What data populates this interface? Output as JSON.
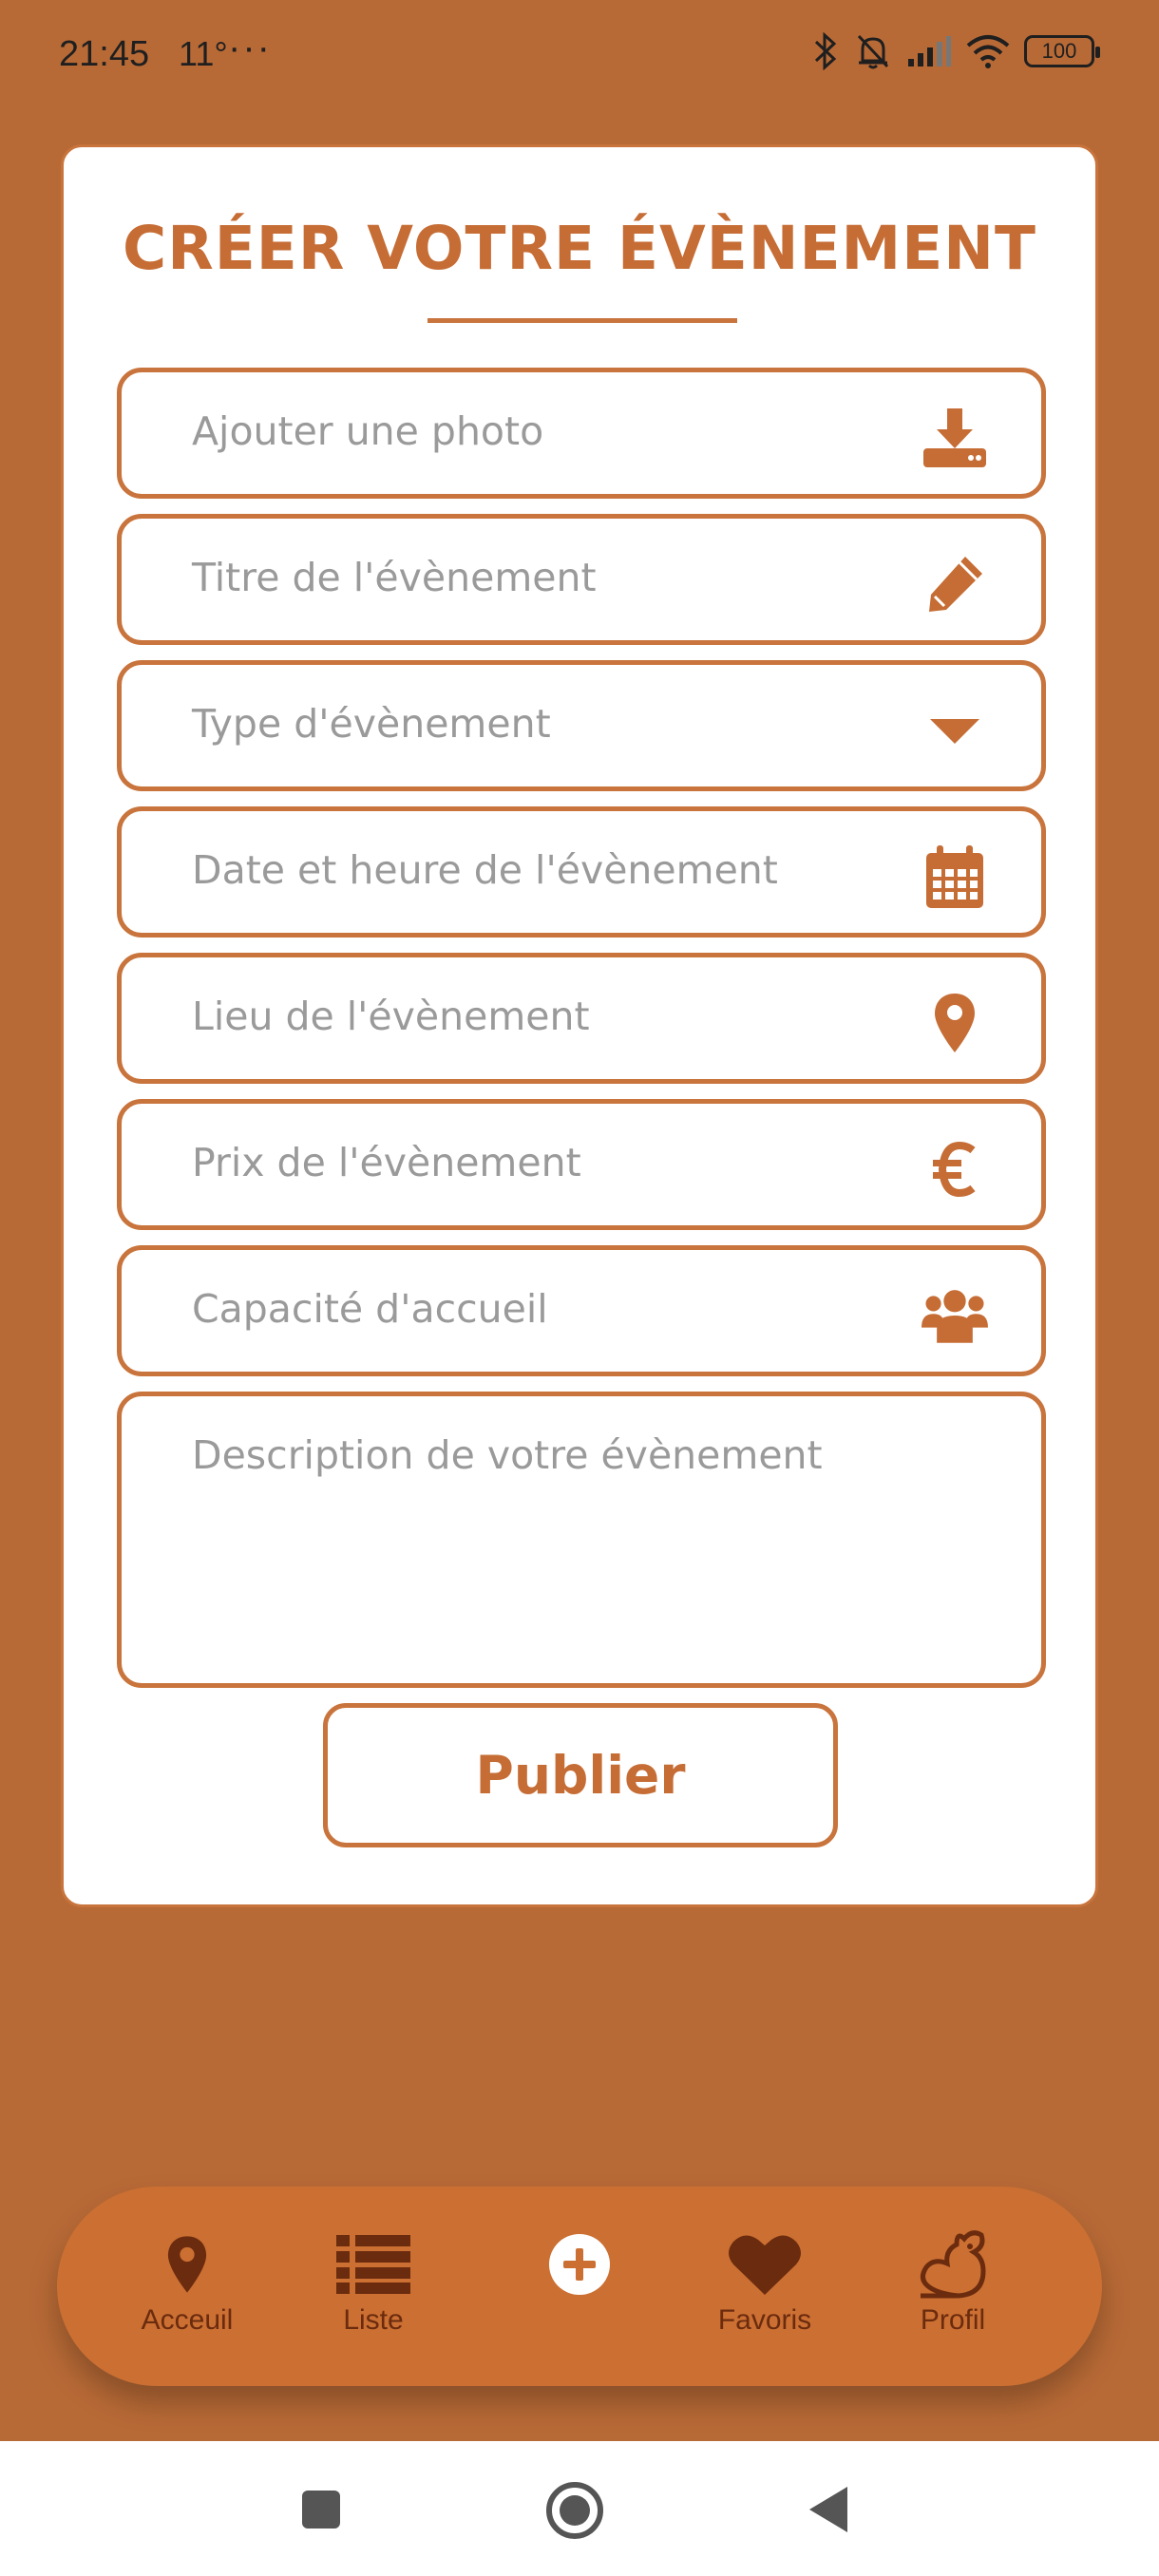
{
  "status_bar": {
    "time": "21:45",
    "temperature": "11°",
    "dots": "···",
    "battery": "100"
  },
  "form": {
    "title": "CRÉER VOTRE ÉVÈNEMENT",
    "fields": [
      {
        "label": "Ajouter une photo",
        "icon": "download-icon"
      },
      {
        "label": "Titre de l'évènement",
        "icon": "pencil-icon"
      },
      {
        "label": "Type d'évènement",
        "icon": "caret-down-icon"
      },
      {
        "label": "Date et heure de l'évènement",
        "icon": "calendar-icon"
      },
      {
        "label": "Lieu de l'évènement",
        "icon": "map-pin-icon"
      },
      {
        "label": "Prix de l'évènement",
        "icon": "euro-icon"
      },
      {
        "label": "Capacité d'accueil",
        "icon": "users-icon"
      }
    ],
    "description_placeholder": "Description de votre évènement",
    "publish_label": "Publier"
  },
  "bottom_nav": {
    "items": [
      {
        "label": "Acceuil",
        "icon": "map-pin-icon"
      },
      {
        "label": "Liste",
        "icon": "list-icon"
      },
      {
        "label": "",
        "icon": "plus-circle-icon"
      },
      {
        "label": "Favoris",
        "icon": "heart-icon"
      },
      {
        "label": "Profil",
        "icon": "squirrel-icon"
      }
    ]
  },
  "colors": {
    "background": "#b86a36",
    "accent": "#c8743c",
    "nav_bg": "#cb6f32",
    "nav_icon": "#6b2b0e",
    "placeholder": "#9a9a9a"
  }
}
